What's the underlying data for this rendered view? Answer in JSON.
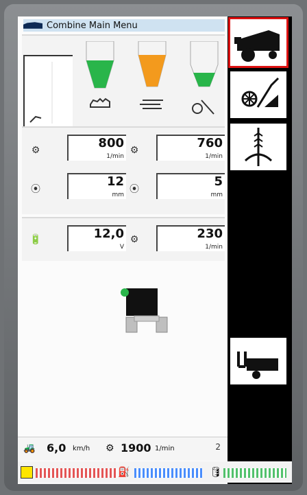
{
  "header": {
    "title": "Combine Main Menu"
  },
  "readouts": {
    "drum_speed": {
      "value": "800",
      "unit": "1/min"
    },
    "fan_speed": {
      "value": "760",
      "unit": "1/min"
    },
    "concave_front": {
      "value": "12",
      "unit": "mm"
    },
    "concave_rear": {
      "value": "5",
      "unit": "mm"
    },
    "voltage": {
      "value": "12,0",
      "unit": "V"
    },
    "rotor_speed": {
      "value": "230",
      "unit": "1/min"
    }
  },
  "status": {
    "speed": {
      "value": "6,0",
      "unit": "km/h"
    },
    "engine": {
      "value": "1900",
      "unit": "1/min"
    },
    "corner": "2"
  },
  "colors": {
    "accent": "#cfe2f1",
    "green": "#29b54a",
    "orange": "#f39a1d",
    "active_border": "#d11111"
  },
  "icons": {
    "combine": "combine-icon",
    "threshing": "threshing-icon",
    "crop": "crop-icon",
    "service": "service-icon"
  }
}
